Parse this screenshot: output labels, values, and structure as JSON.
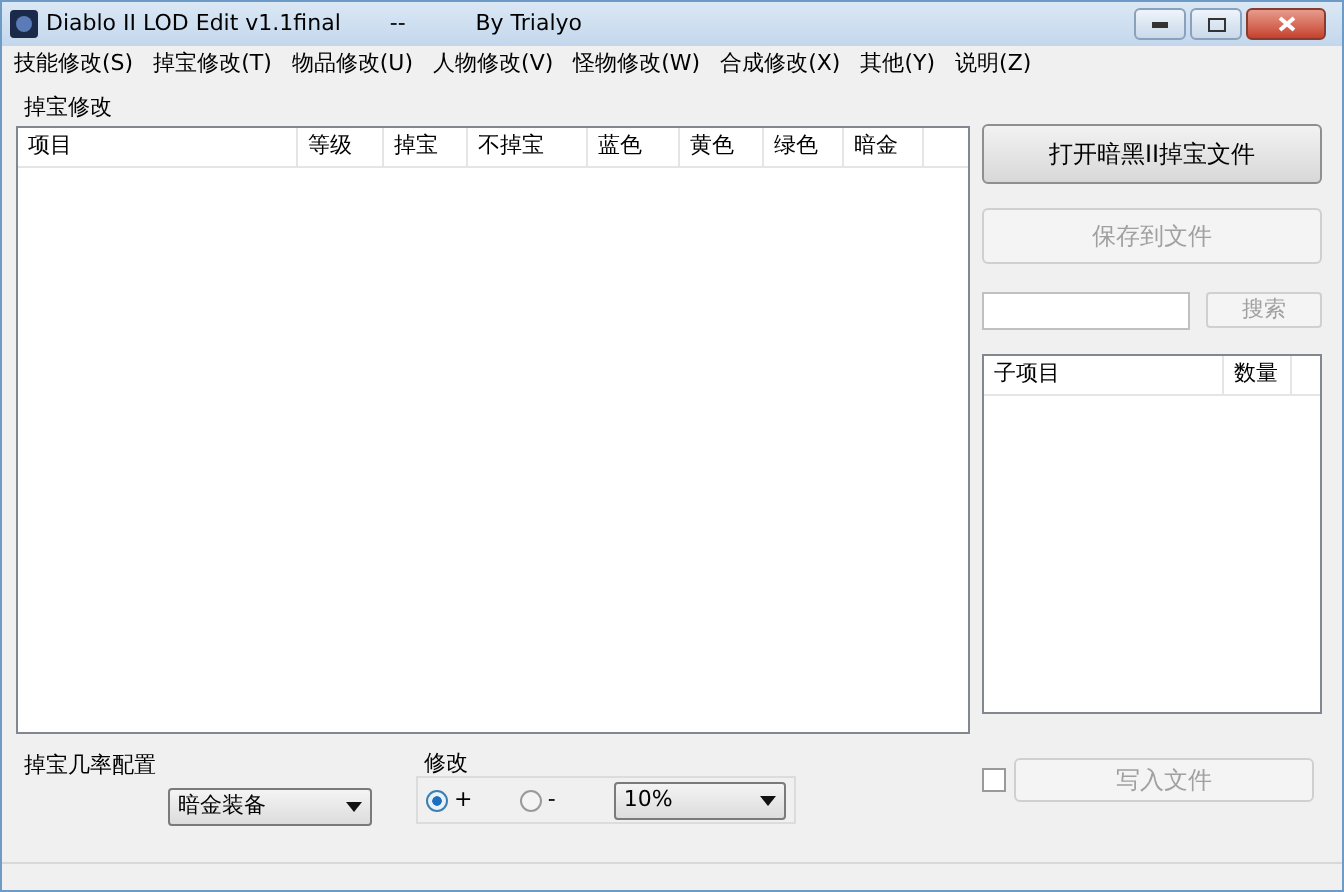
{
  "window": {
    "title": "Diablo II LOD Edit v1.1final       --          By Trialyo"
  },
  "menu": [
    "技能修改(S)",
    "掉宝修改(T)",
    "物品修改(U)",
    "人物修改(V)",
    "怪物修改(W)",
    "合成修改(X)",
    "其他(Y)",
    "说明(Z)"
  ],
  "group": {
    "title": "掉宝修改"
  },
  "table": {
    "columns": [
      "项目",
      "等级",
      "掉宝",
      "不掉宝",
      "蓝色",
      "黄色",
      "绿色",
      "暗金"
    ]
  },
  "buttons": [
    {
      "label": "打开暗黑II掉宝文件",
      "disabled": false
    },
    {
      "label": "保存到文件",
      "disabled": true
    }
  ],
  "search": {
    "button": "搜索",
    "disabled": true
  },
  "sub_table": {
    "columns": [
      "子项目",
      "数量"
    ]
  },
  "drop_config": {
    "label": "掉宝几率配置",
    "value": "暗金装备"
  },
  "modify": {
    "title": "修改",
    "options": [
      {
        "label": "+",
        "selected": true
      },
      {
        "label": "-",
        "selected": false
      }
    ],
    "value": "10%"
  },
  "write_button": {
    "label": "写入文件",
    "disabled": true,
    "checked": false
  }
}
